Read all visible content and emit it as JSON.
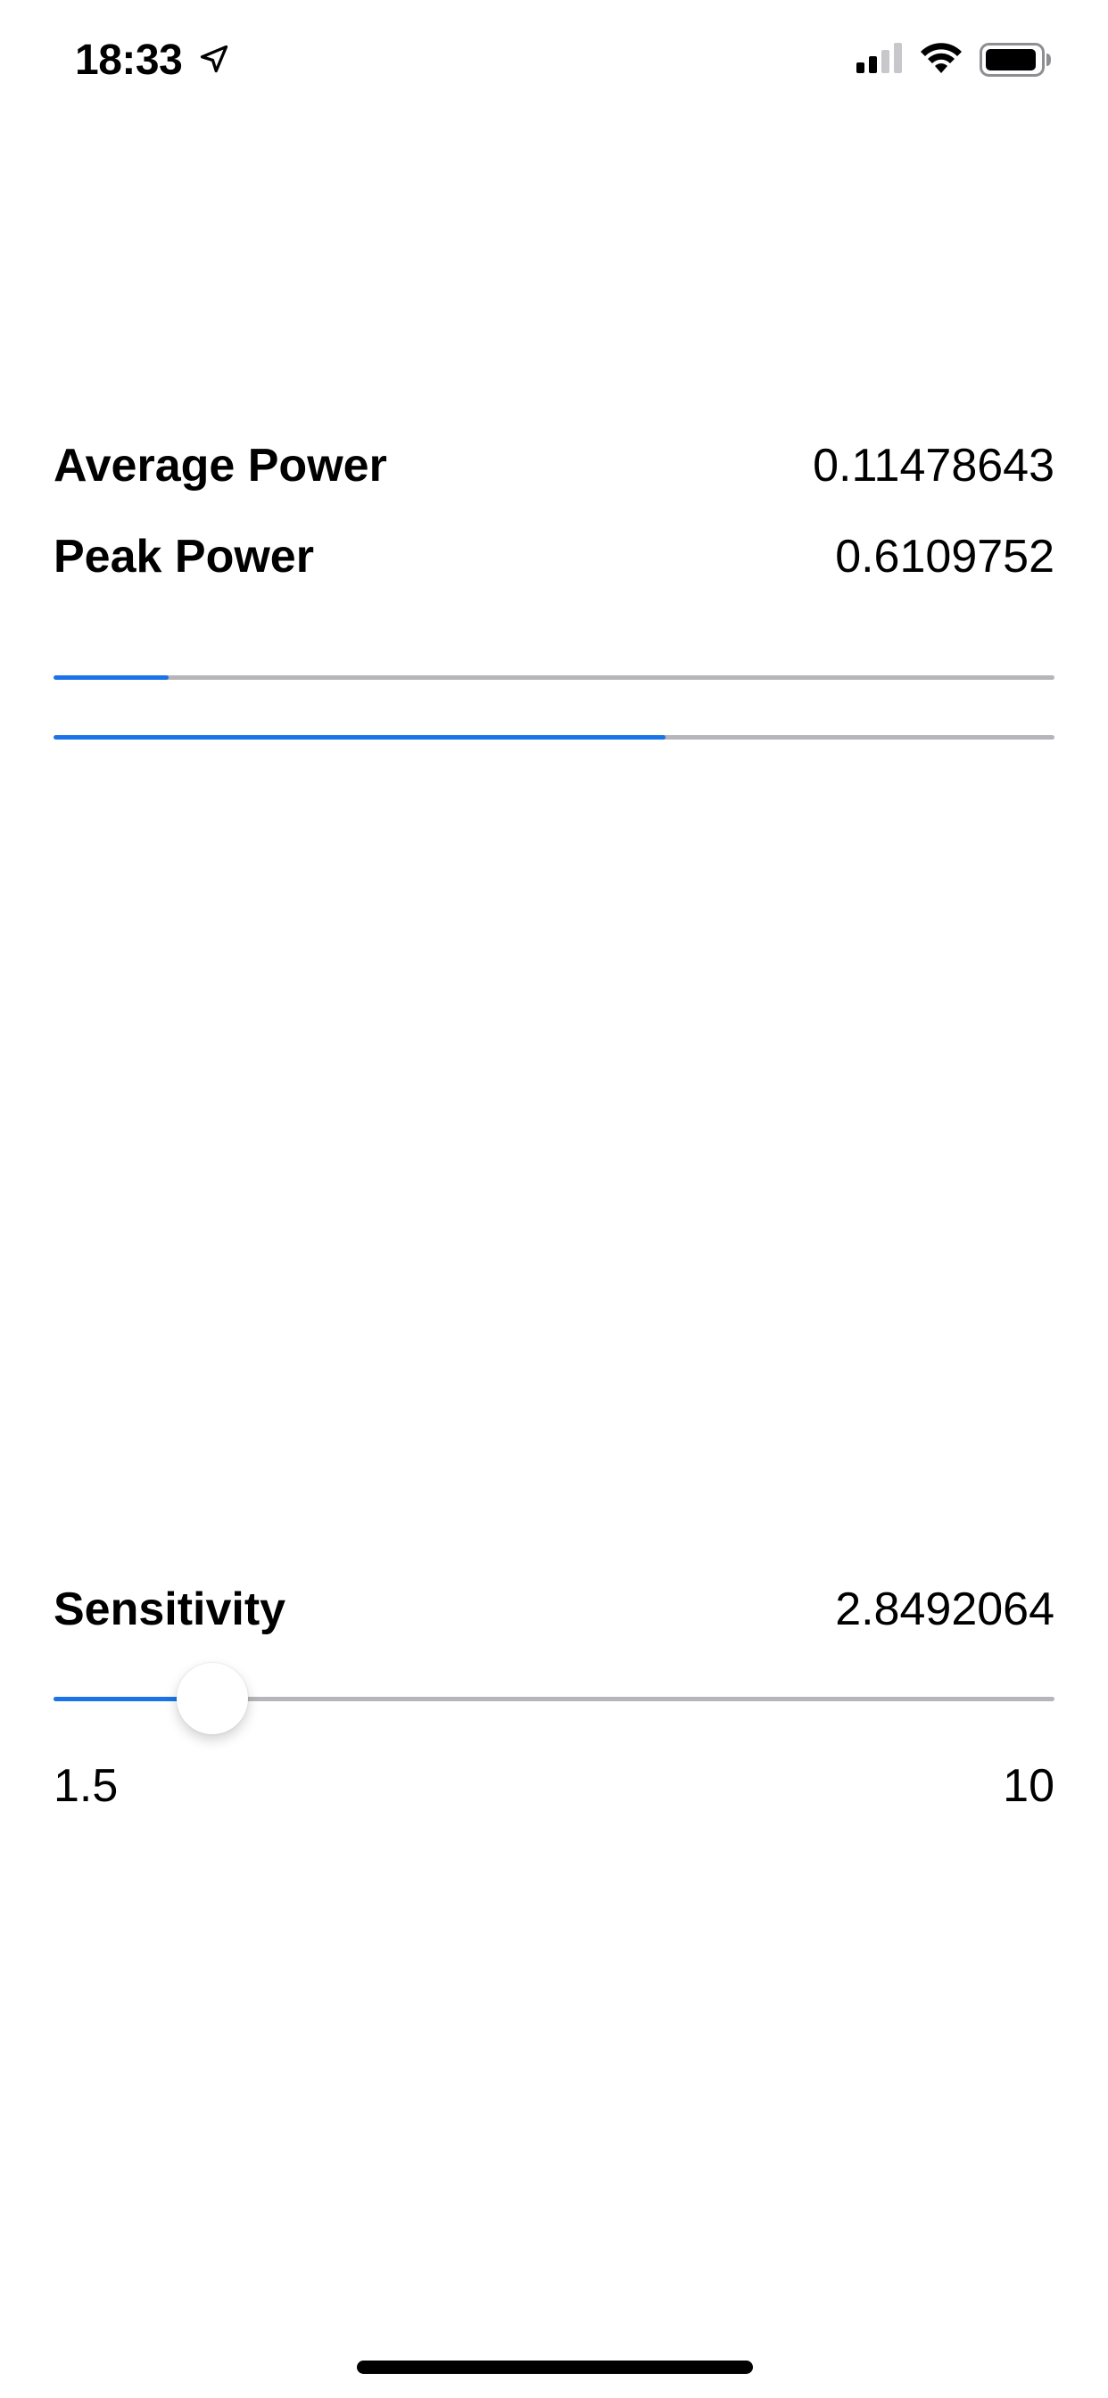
{
  "status_bar": {
    "time": "18:33",
    "location_icon": "location-arrow-icon",
    "signal_icon": "cellular-signal-icon",
    "wifi_icon": "wifi-icon",
    "battery_icon": "battery-icon"
  },
  "metrics": {
    "average_power": {
      "label": "Average Power",
      "value": "0.11478643"
    },
    "peak_power": {
      "label": "Peak Power",
      "value": "0.6109752"
    }
  },
  "meters": {
    "average_fill_fraction": 0.11478643,
    "peak_fill_fraction": 0.6109752
  },
  "sensitivity": {
    "label": "Sensitivity",
    "value": "2.8492064",
    "numeric_value": 2.8492064,
    "min_label": "1.5",
    "max_label": "10",
    "min": 1.5,
    "max": 10
  },
  "colors": {
    "accent": "#1a73e8",
    "track": "#b6b6ba",
    "background": "#ffffff",
    "text": "#000000"
  }
}
